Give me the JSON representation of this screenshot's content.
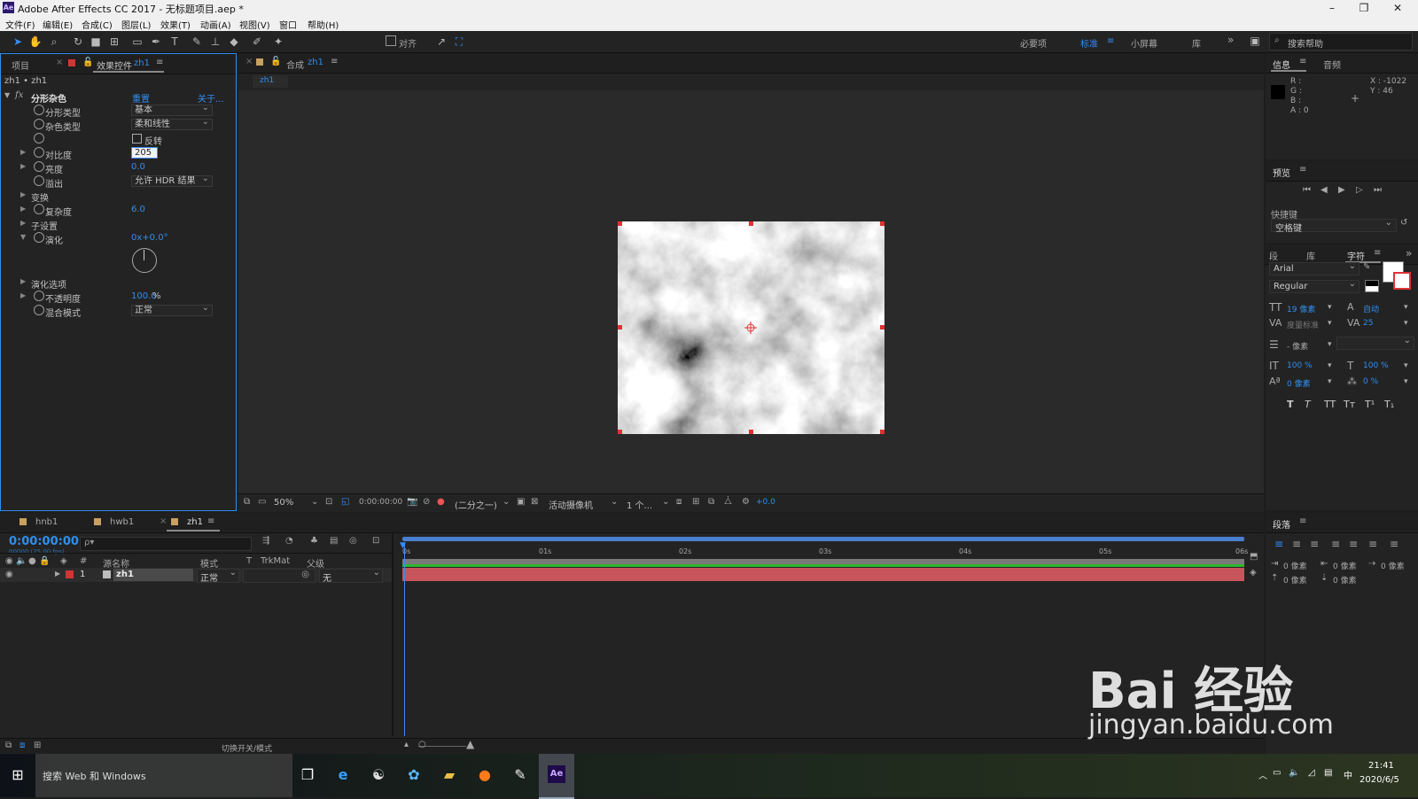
{
  "window": {
    "title": "Adobe After Effects CC 2017 - 无标题项目.aep *",
    "app_icon": "Ae"
  },
  "menu": [
    "文件(F)",
    "编辑(E)",
    "合成(C)",
    "图层(L)",
    "效果(T)",
    "动画(A)",
    "视图(V)",
    "窗口",
    "帮助(H)"
  ],
  "toolbar": {
    "snap_label": "对齐",
    "workspaces": [
      "必要项",
      "标准",
      "小屏幕",
      "库"
    ],
    "active_workspace": "标准",
    "search_placeholder": "搜索帮助"
  },
  "project_panel": {
    "tab_project": "项目",
    "tab_effects": "效果控件",
    "tab_effects_layer": "zh1",
    "breadcrumb": "zh1 • zh1",
    "effect_name": "分形杂色",
    "reset": "重置",
    "about": "关于...",
    "props": {
      "fractal_type": {
        "label": "分形类型",
        "value": "基本"
      },
      "noise_type": {
        "label": "杂色类型",
        "value": "柔和线性"
      },
      "invert": {
        "label": "反转"
      },
      "contrast": {
        "label": "对比度",
        "value": "205"
      },
      "brightness": {
        "label": "亮度",
        "value": "0.0"
      },
      "overflow": {
        "label": "溢出",
        "value": "允许 HDR 结果"
      },
      "transform": {
        "label": "变换"
      },
      "complexity": {
        "label": "复杂度",
        "value": "6.0"
      },
      "sub_settings": {
        "label": "子设置"
      },
      "evolution": {
        "label": "演化",
        "value": "0x+0.0°"
      },
      "evolution_options": {
        "label": "演化选项"
      },
      "opacity": {
        "label": "不透明度",
        "value": "100.0",
        "unit": "%"
      },
      "blend_mode": {
        "label": "混合模式",
        "value": "正常"
      }
    }
  },
  "comp_panel": {
    "tab_label": "合成",
    "tab_comp": "zh1",
    "sub_tab": "zh1",
    "footer": {
      "zoom": "50%",
      "time": "0:00:00:00",
      "resolution": "(二分之一)",
      "camera": "活动摄像机",
      "views": "1 个...",
      "exposure": "+0.0"
    }
  },
  "info_panel": {
    "tab_info": "信息",
    "tab_audio": "音频",
    "r": "R :",
    "g": "G :",
    "b": "B :",
    "a": "A : 0",
    "x": "X : -1022",
    "y": "Y : 46"
  },
  "preview_panel": {
    "title": "预览",
    "shortcut_label": "快捷键",
    "shortcut_value": "空格键"
  },
  "char_panel": {
    "tab_paragraph": "段",
    "tab_library": "库",
    "tab_character": "字符",
    "font": "Arial",
    "style": "Regular",
    "font_size": "19 像素",
    "leading": "自动",
    "kerning": "度量标准",
    "tracking": "25",
    "stroke": "- 像素",
    "vscale": "100 %",
    "hscale": "100 %",
    "baseline": "0 像素",
    "tsume": "0 %",
    "styles": [
      "T",
      "T",
      "TT",
      "Tт",
      "T¹",
      "T₁"
    ]
  },
  "paragraph_panel": {
    "title": "段落",
    "indent_left": "0 像素",
    "indent_right": "0 像素",
    "indent_first": "0 像素",
    "space_before": "0 像素",
    "space_after": "0 像素"
  },
  "timeline": {
    "tabs": [
      "hnb1",
      "hwb1",
      "zh1"
    ],
    "active_tab": "zh1",
    "timecode": "0:00:00:00",
    "fps": "00000 (25.00 fps)",
    "search_placeholder": "ρ▾",
    "headers": {
      "num": "#",
      "source": "源名称",
      "mode": "模式",
      "t": "T",
      "trkmat": "TrkMat",
      "parent": "父级"
    },
    "layer": {
      "num": "1",
      "name": "zh1",
      "mode": "正常",
      "parent": "无"
    },
    "ruler": [
      "0s",
      "01s",
      "02s",
      "03s",
      "04s",
      "05s",
      "06s"
    ],
    "footer_label": "切换开关/模式"
  },
  "taskbar": {
    "search_text": "搜索 Web 和 Windows",
    "time": "21:41",
    "date": "2020/6/5",
    "ime": "中"
  },
  "watermark": {
    "brand": "Bai 经验",
    "url": "jingyan.baidu.com"
  },
  "colors": {
    "accent": "#2f8ff0",
    "layer_bar": "#c8545c",
    "label_red": "#d03535"
  }
}
